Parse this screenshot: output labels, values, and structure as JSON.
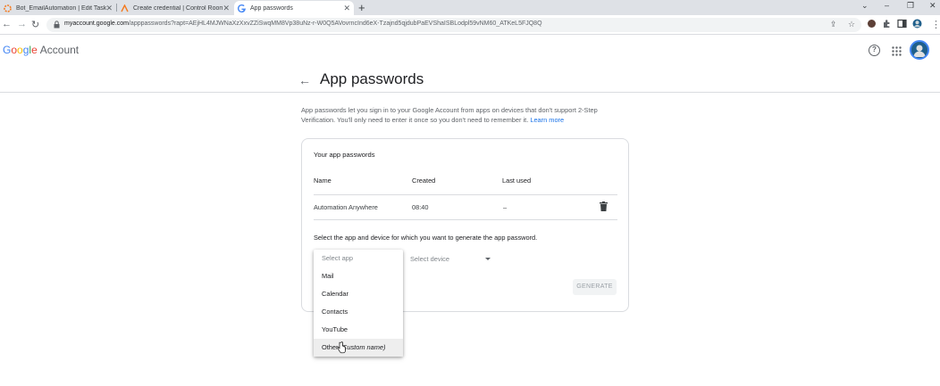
{
  "browser": {
    "tabs": [
      {
        "title": "Bot_EmailAutomation | Edit Task",
        "favicon": "automation-anywhere-icon"
      },
      {
        "title": "Create credential | Control Room",
        "favicon": "automation-anywhere-icon"
      },
      {
        "title": "App passwords",
        "favicon": "google-icon",
        "active": true
      }
    ],
    "url_host": "myaccount.google.com",
    "url_rest": "/apppasswords?rapt=AEjHL4MJWNaXzXxvZZiSwqMM8Vp38uNz-r-W0Q5AVovrncInd6eX-Tzajnd5qjdubPaEVShaISBLodpl59vNM60_ATKeL5FJQ8Q"
  },
  "header": {
    "logo_google": [
      "G",
      "o",
      "o",
      "g",
      "l",
      "e"
    ],
    "logo_account": "Account"
  },
  "page": {
    "title": "App passwords",
    "description": "App passwords let you sign in to your Google Account from apps on devices that don't support 2-Step Verification. You'll only need to enter it once so you don't need to remember it.",
    "learn_more": "Learn more"
  },
  "card": {
    "title": "Your app passwords",
    "columns": {
      "name": "Name",
      "created": "Created",
      "last_used": "Last used"
    },
    "rows": [
      {
        "name": "Automation Anywhere",
        "created": "08:40",
        "last_used": "–"
      }
    ],
    "select_prompt": "Select the app and device for which you want to generate the app password.",
    "device_placeholder": "Select device",
    "generate_label": "GENERATE"
  },
  "dropdown": {
    "placeholder": "Select app",
    "options": [
      "Mail",
      "Calendar",
      "Contacts",
      "YouTube"
    ],
    "other_label": "Other",
    "other_hint": "(Custom name)"
  },
  "colors": {
    "link": "#1a73e8",
    "google_blue": "#4285f4",
    "google_red": "#ea4335",
    "google_yellow": "#fbbc05",
    "google_green": "#34a853"
  }
}
